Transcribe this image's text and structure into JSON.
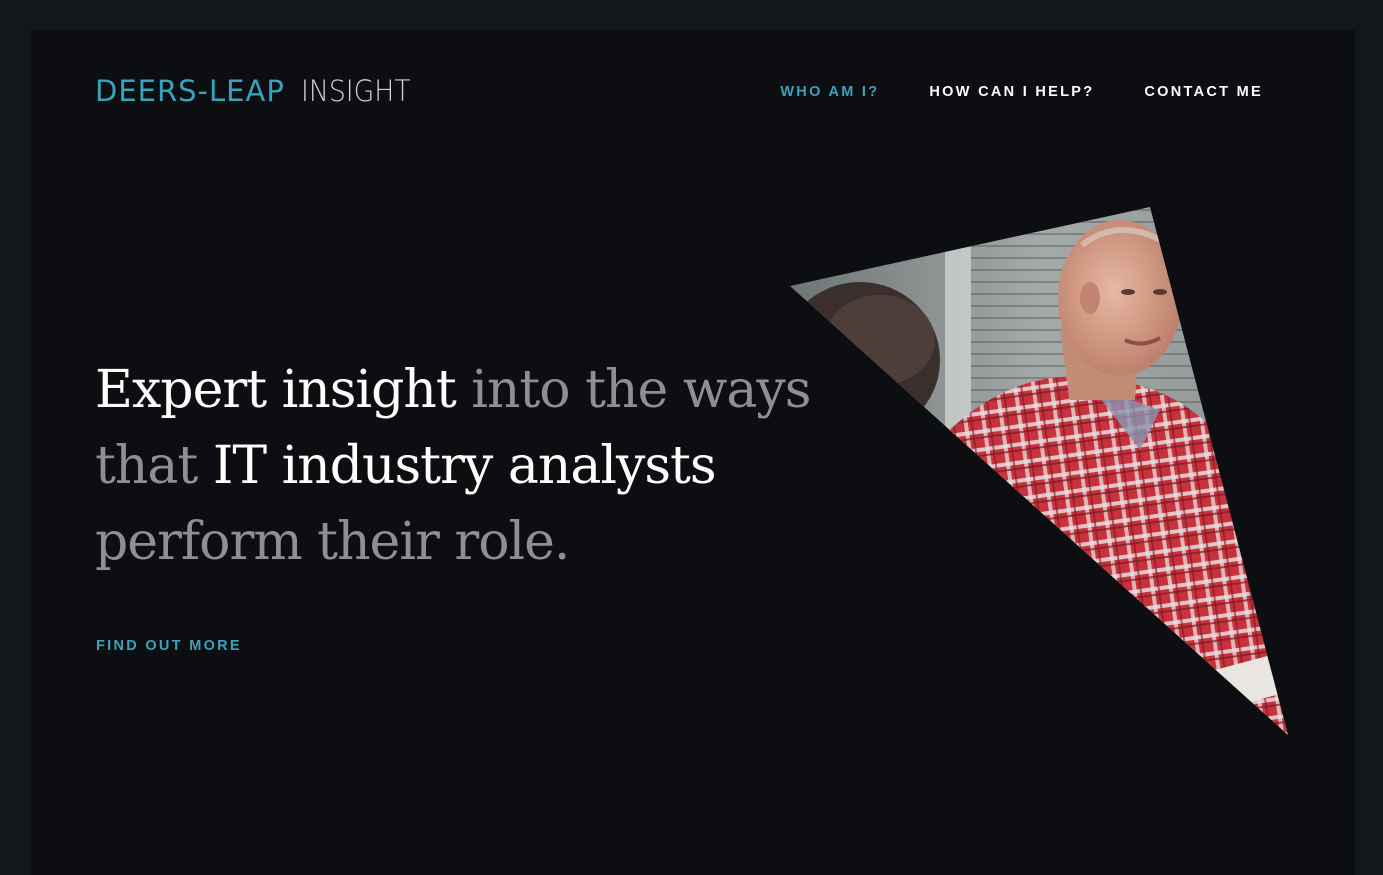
{
  "logo": {
    "brand": "DEERS-LEAP",
    "product": "INSIGHT"
  },
  "nav": {
    "items": [
      {
        "label": "WHO AM I?",
        "active": true
      },
      {
        "label": "HOW CAN I HELP?",
        "active": false
      },
      {
        "label": "CONTACT ME",
        "active": false
      }
    ]
  },
  "hero": {
    "headline": {
      "part1": "Expert insight",
      "part2": " into the ways that ",
      "part3": "IT industry analysts",
      "part4": " perform their role."
    },
    "cta_label": "FIND OUT MORE"
  },
  "colors": {
    "accent": "#3aa3bb",
    "background": "#0d0e11",
    "outer": "#13171b",
    "dim_text": "#8d8f93"
  },
  "icons": {
    "photo": "man-in-red-plaid-shirt-photo"
  }
}
